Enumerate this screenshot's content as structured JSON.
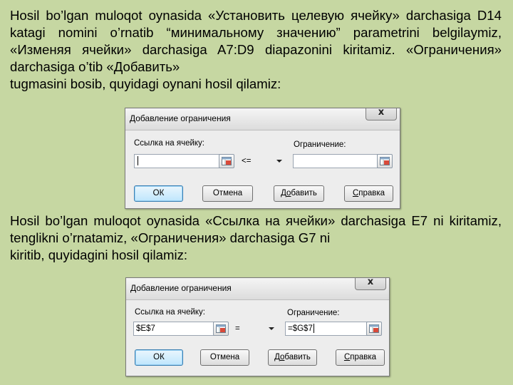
{
  "paragraph1": {
    "text": "Hosil bo’lgan muloqot oynasida «Установить целевую ячейку» darchasiga D14 katagi nomini o’rnatib “минимальному значению” parametrini belgilaymiz, «Изменяя ячейки» darchasiga A7:D9 diapazonini kiritamiz. «Ограничения» darchasiga o’tib «Добавить»",
    "last_line": "tugmasini bosib, quyidagi oynani hosil qilamiz:"
  },
  "paragraph2": {
    "text": "Hosil bo’lgan muloqot oynasida «Ссылка на ячейки» darchasiga E7 ni kiritamiz, tenglikni o’rnatamiz, «Ограничения» darchasiga G7 ni",
    "last_line": "kiritib, quyidagini hosil qilamiz:"
  },
  "dialog1": {
    "title": "Добавление ограничения",
    "close_label": "x",
    "cell_ref_label": "Ссылка на ячейку:",
    "cell_ref_value": "",
    "operator_value": "<=",
    "constraint_label": "Ограничение:",
    "constraint_value": "",
    "buttons": {
      "ok": "ОК",
      "cancel": "Отмена",
      "add_pre": "Д",
      "add_u": "о",
      "add_post": "бавить",
      "help_pre": "",
      "help_u": "С",
      "help_post": "правка"
    }
  },
  "dialog2": {
    "title": "Добавление ограничения",
    "close_label": "x",
    "cell_ref_label": "Ссылка на ячейку:",
    "cell_ref_value": "$E$7",
    "operator_value": "=",
    "constraint_label": "Ограничение:",
    "constraint_value": "=$G$7",
    "buttons": {
      "ok": "ОК",
      "cancel": "Отмена",
      "add_pre": "Д",
      "add_u": "о",
      "add_post": "бавить",
      "help_pre": "",
      "help_u": "С",
      "help_post": "правка"
    }
  },
  "colors": {
    "background": "#c6d7a2",
    "dialog": "#ededed",
    "default_button": "#bee6fd"
  },
  "icons": {
    "reference_button": "range-select-icon",
    "dropdown": "chevron-down-icon"
  }
}
